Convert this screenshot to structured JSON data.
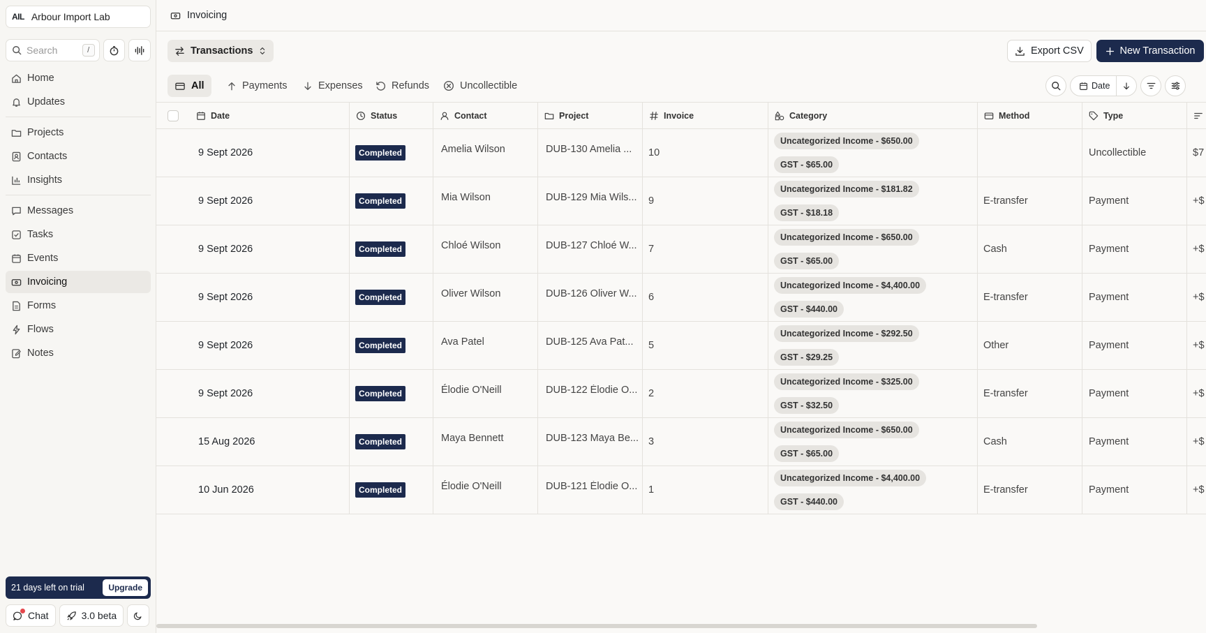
{
  "workspace": {
    "abbr": "AIL",
    "name": "Arbour Import Lab"
  },
  "search": {
    "placeholder": "Search",
    "shortcut": "/"
  },
  "nav": {
    "group1": [
      {
        "label": "Home",
        "icon": "home-icon"
      },
      {
        "label": "Updates",
        "icon": "bell-icon"
      }
    ],
    "group2": [
      {
        "label": "Projects",
        "icon": "folder-icon"
      },
      {
        "label": "Contacts",
        "icon": "contact-icon"
      },
      {
        "label": "Insights",
        "icon": "chart-icon"
      }
    ],
    "group3": [
      {
        "label": "Messages",
        "icon": "message-icon"
      },
      {
        "label": "Tasks",
        "icon": "check-square-icon"
      },
      {
        "label": "Events",
        "icon": "calendar-icon"
      },
      {
        "label": "Invoicing",
        "icon": "invoice-icon",
        "active": true
      },
      {
        "label": "Forms",
        "icon": "form-icon"
      },
      {
        "label": "Flows",
        "icon": "lightning-icon"
      },
      {
        "label": "Notes",
        "icon": "note-icon"
      }
    ]
  },
  "trial": {
    "text": "21 days left on trial",
    "upgrade": "Upgrade"
  },
  "bottom": {
    "chat": "Chat",
    "beta": "3.0 beta"
  },
  "page": {
    "title": "Invoicing"
  },
  "toolbar": {
    "view": "Transactions",
    "export": "Export CSV",
    "new": "New Transaction"
  },
  "tabs": [
    {
      "label": "All",
      "icon": "card-icon",
      "active": true
    },
    {
      "label": "Payments",
      "icon": "arrow-up-icon"
    },
    {
      "label": "Expenses",
      "icon": "arrow-down-icon"
    },
    {
      "label": "Refunds",
      "icon": "refund-icon"
    },
    {
      "label": "Uncollectible",
      "icon": "x-circle-icon"
    }
  ],
  "sort": {
    "label": "Date"
  },
  "columns": {
    "date": "Date",
    "status": "Status",
    "contact": "Contact",
    "project": "Project",
    "invoice": "Invoice",
    "category": "Category",
    "method": "Method",
    "type": "Type"
  },
  "rows": [
    {
      "date": "9 Sept 2026",
      "status": "Completed",
      "contact": "Amelia Wilson",
      "project": "DUB-130 Amelia ...",
      "invoice": "10",
      "cat1": "Uncategorized Income - $650.00",
      "cat2": "GST - $65.00",
      "method": "",
      "type": "Uncollectible",
      "amount": "$7"
    },
    {
      "date": "9 Sept 2026",
      "status": "Completed",
      "contact": "Mia Wilson",
      "project": "DUB-129 Mia Wils...",
      "invoice": "9",
      "cat1": "Uncategorized Income - $181.82",
      "cat2": "GST - $18.18",
      "method": "E-transfer",
      "type": "Payment",
      "amount": "+$"
    },
    {
      "date": "9 Sept 2026",
      "status": "Completed",
      "contact": "Chloé Wilson",
      "project": "DUB-127 Chloé W...",
      "invoice": "7",
      "cat1": "Uncategorized Income - $650.00",
      "cat2": "GST - $65.00",
      "method": "Cash",
      "type": "Payment",
      "amount": "+$"
    },
    {
      "date": "9 Sept 2026",
      "status": "Completed",
      "contact": "Oliver Wilson",
      "project": "DUB-126 Oliver W...",
      "invoice": "6",
      "cat1": "Uncategorized Income - $4,400.00",
      "cat2": "GST - $440.00",
      "method": "E-transfer",
      "type": "Payment",
      "amount": "+$"
    },
    {
      "date": "9 Sept 2026",
      "status": "Completed",
      "contact": "Ava Patel",
      "project": "DUB-125 Ava Pat...",
      "invoice": "5",
      "cat1": "Uncategorized Income - $292.50",
      "cat2": "GST - $29.25",
      "method": "Other",
      "type": "Payment",
      "amount": "+$"
    },
    {
      "date": "9 Sept 2026",
      "status": "Completed",
      "contact": "Élodie O'Neill",
      "project": "DUB-122 Élodie O...",
      "invoice": "2",
      "cat1": "Uncategorized Income - $325.00",
      "cat2": "GST - $32.50",
      "method": "E-transfer",
      "type": "Payment",
      "amount": "+$"
    },
    {
      "date": "15 Aug 2026",
      "status": "Completed",
      "contact": "Maya Bennett",
      "project": "DUB-123 Maya Be...",
      "invoice": "3",
      "cat1": "Uncategorized Income - $650.00",
      "cat2": "GST - $65.00",
      "method": "Cash",
      "type": "Payment",
      "amount": "+$"
    },
    {
      "date": "10 Jun 2026",
      "status": "Completed",
      "contact": "Élodie O'Neill",
      "project": "DUB-121 Élodie O...",
      "invoice": "1",
      "cat1": "Uncategorized Income - $4,400.00",
      "cat2": "GST - $440.00",
      "method": "E-transfer",
      "type": "Payment",
      "amount": "+$"
    }
  ],
  "colors": {
    "accent": "#1c2a4d",
    "sidebar": "#f7f6f3",
    "pill": "#e6e4e0",
    "notify": "#e5484d"
  }
}
